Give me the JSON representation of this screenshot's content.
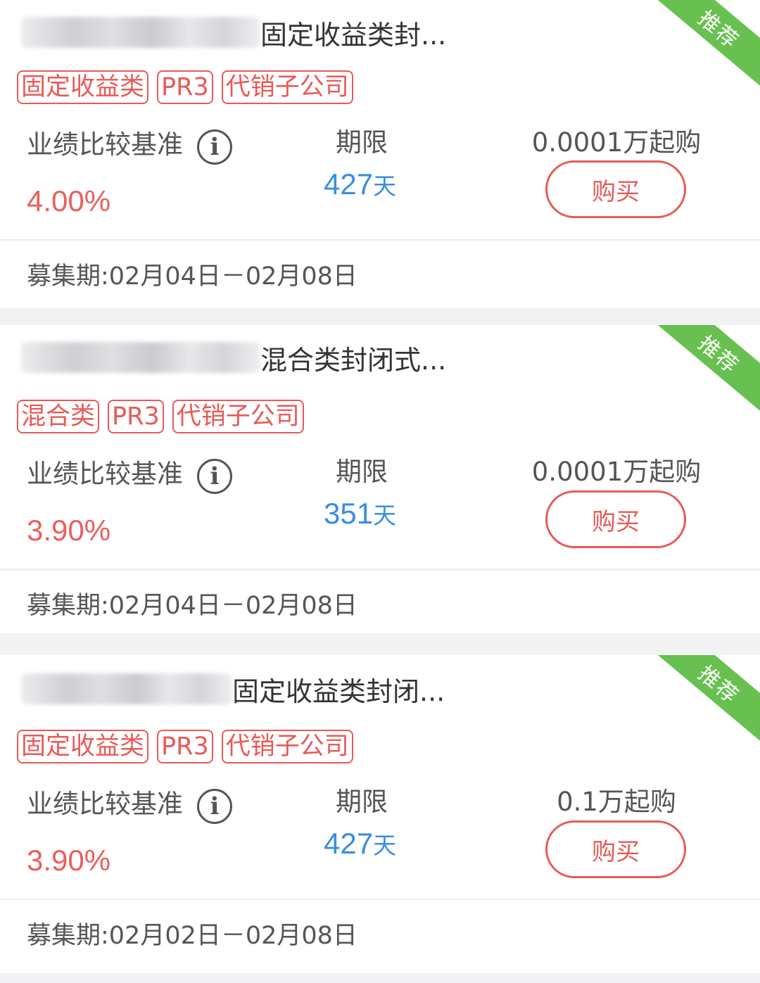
{
  "products": [
    {
      "title_suffix": "固定收益类封...",
      "tags": [
        "固定收益类",
        "PR3",
        "代销子公司"
      ],
      "rate_label": "业绩比较基准",
      "rate": "4.00%",
      "term_label": "期限",
      "term_value": "427",
      "term_unit": "天",
      "min_buy": "0.0001万起购",
      "buy_label": "购买",
      "period": "募集期:02月04日－02月08日",
      "badge": "推荐"
    },
    {
      "title_suffix": "混合类封闭式...",
      "tags": [
        "混合类",
        "PR3",
        "代销子公司"
      ],
      "rate_label": "业绩比较基准",
      "rate": "3.90%",
      "term_label": "期限",
      "term_value": "351",
      "term_unit": "天",
      "min_buy": "0.0001万起购",
      "buy_label": "购买",
      "period": "募集期:02月04日－02月08日",
      "badge": "推荐"
    },
    {
      "title_suffix": "固定收益类封闭...",
      "tags": [
        "固定收益类",
        "PR3",
        "代销子公司"
      ],
      "rate_label": "业绩比较基准",
      "rate": "3.90%",
      "term_label": "期限",
      "term_value": "427",
      "term_unit": "天",
      "min_buy": "0.1万起购",
      "buy_label": "购买",
      "period": "募集期:02月02日－02月08日",
      "badge": "推荐"
    }
  ]
}
